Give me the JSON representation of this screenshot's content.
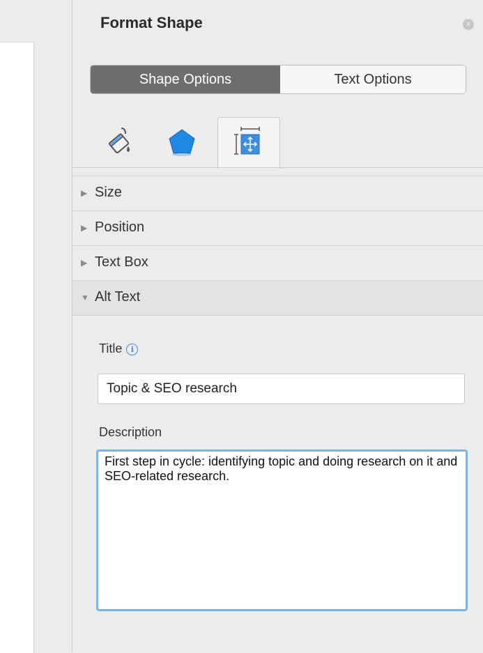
{
  "pane": {
    "title": "Format Shape",
    "close_label": "×",
    "tabs": {
      "shape_options": "Shape Options",
      "text_options": "Text Options"
    },
    "icon_tabs": [
      "paint-bucket-icon",
      "pentagon-icon",
      "size-properties-icon"
    ]
  },
  "sections": [
    {
      "label": "Size",
      "state": "collapsed",
      "arrow": "▶"
    },
    {
      "label": "Position",
      "state": "collapsed",
      "arrow": "▶"
    },
    {
      "label": "Text Box",
      "state": "collapsed",
      "arrow": "▶"
    },
    {
      "label": "Alt Text",
      "state": "expanded",
      "arrow": "▼"
    }
  ],
  "alt_text": {
    "title_label": "Title",
    "info_label": "i",
    "title_value": "Topic & SEO research",
    "description_label": "Description",
    "description_value": "First step in cycle: identifying topic and doing research on it and SEO-related research."
  },
  "colors": {
    "active_tab": "#6e6e6e",
    "focus_ring": "#7ab3e8",
    "info": "#3b8fdc",
    "pentagon": "#1e88e5"
  }
}
